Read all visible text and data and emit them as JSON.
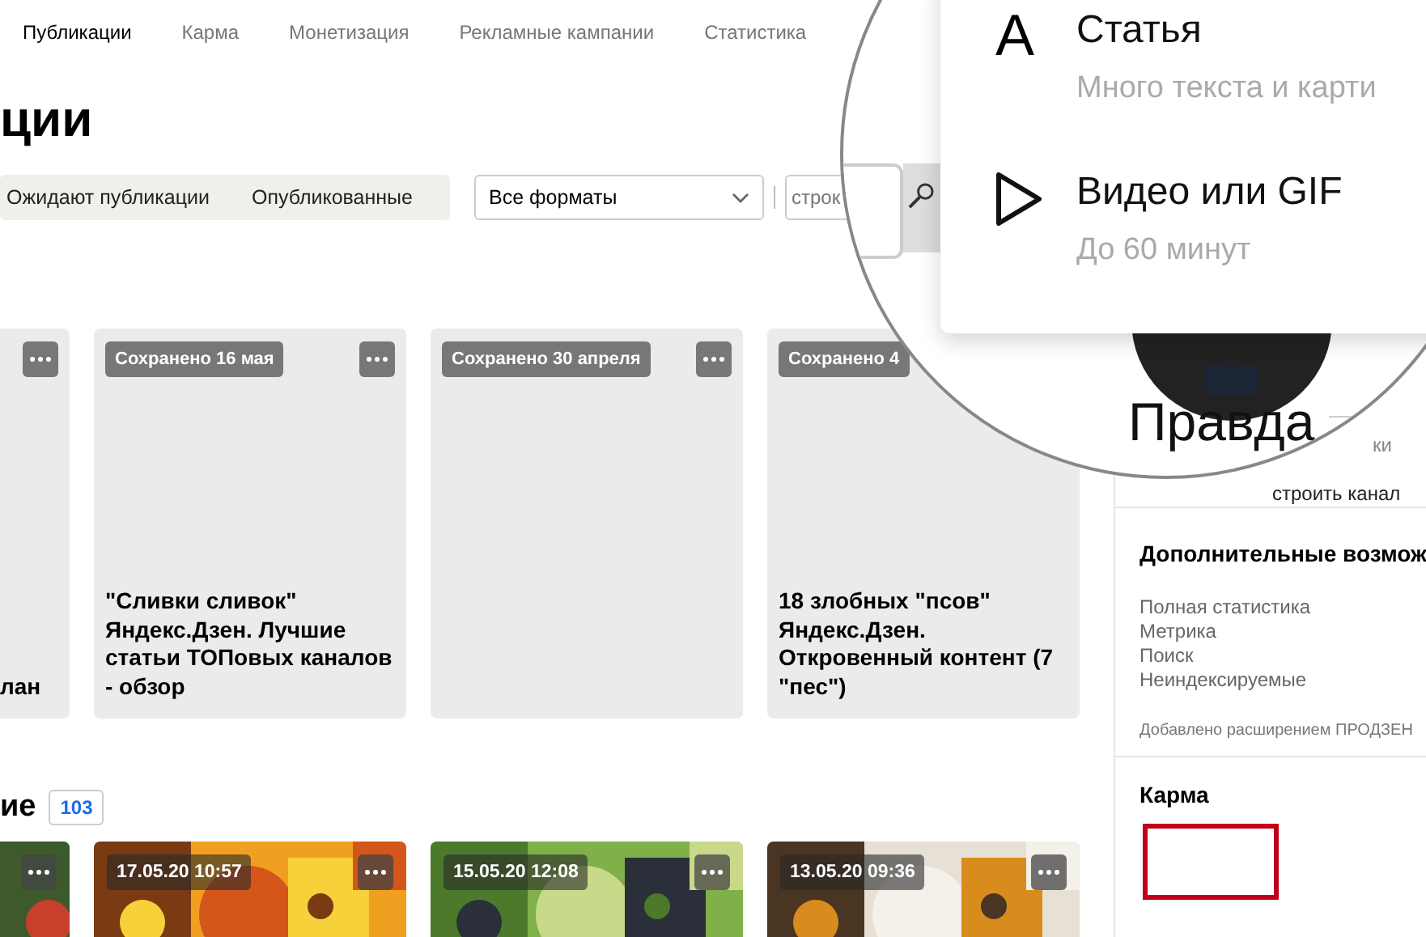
{
  "nav_tabs": [
    {
      "label": "Публикации",
      "selected": true
    },
    {
      "label": "Карма",
      "selected": false
    },
    {
      "label": "Монетизация",
      "selected": false
    },
    {
      "label": "Рекламные кампании",
      "selected": false
    },
    {
      "label": "Статистика",
      "selected": false
    }
  ],
  "page_title": "ции",
  "status_tabs": [
    {
      "label": "Ожидают публикации",
      "selected": false
    },
    {
      "label": "Опубликованные",
      "selected": false
    }
  ],
  "format_select": {
    "value": "Все форматы"
  },
  "search": {
    "placeholder": "строк"
  },
  "drafts": [
    {
      "title": "лан"
    },
    {
      "badge": "Сохранено 16 мая",
      "title": "\"Сливки сливок\" Яндекс.Дзен. Лучшие статьи ТОПовых каналов - обзор"
    },
    {
      "badge": "Сохранено 30 апреля"
    },
    {
      "badge": "Сохранено 4",
      "title": "18 злобных \"псов\" Яндекс.Дзен. Откровенный контент (7 \"пес\")"
    }
  ],
  "published": {
    "heading": "ие",
    "count": "103",
    "items": [
      {
        "kind": "picture"
      },
      {
        "date": "17.05.20 10:57",
        "kind": "picture"
      },
      {
        "date": "15.05.20 12:08",
        "kind": "picture"
      },
      {
        "date": "13.05.20 09:36",
        "kind": "picture"
      }
    ]
  },
  "sidebar": {
    "extra_title": "Дополнительные возмож",
    "extra_items": [
      "Полная статистика",
      "Метрика",
      "Поиск",
      "Неиндексируемые"
    ],
    "extra_note": "Добавлено расширением ПРОДЗЕН",
    "karma_title": "Карма"
  },
  "magnifier": {
    "menu": [
      {
        "kind": "article",
        "icon": "A",
        "title": "Статья",
        "subtitle": "Много текста и карти"
      },
      {
        "kind": "video",
        "title": "Видео или GIF",
        "subtitle": "До 60 минут"
      }
    ],
    "channel_name": "Правда",
    "channel_link": "строить канал",
    "caption_fragment": "ки"
  }
}
